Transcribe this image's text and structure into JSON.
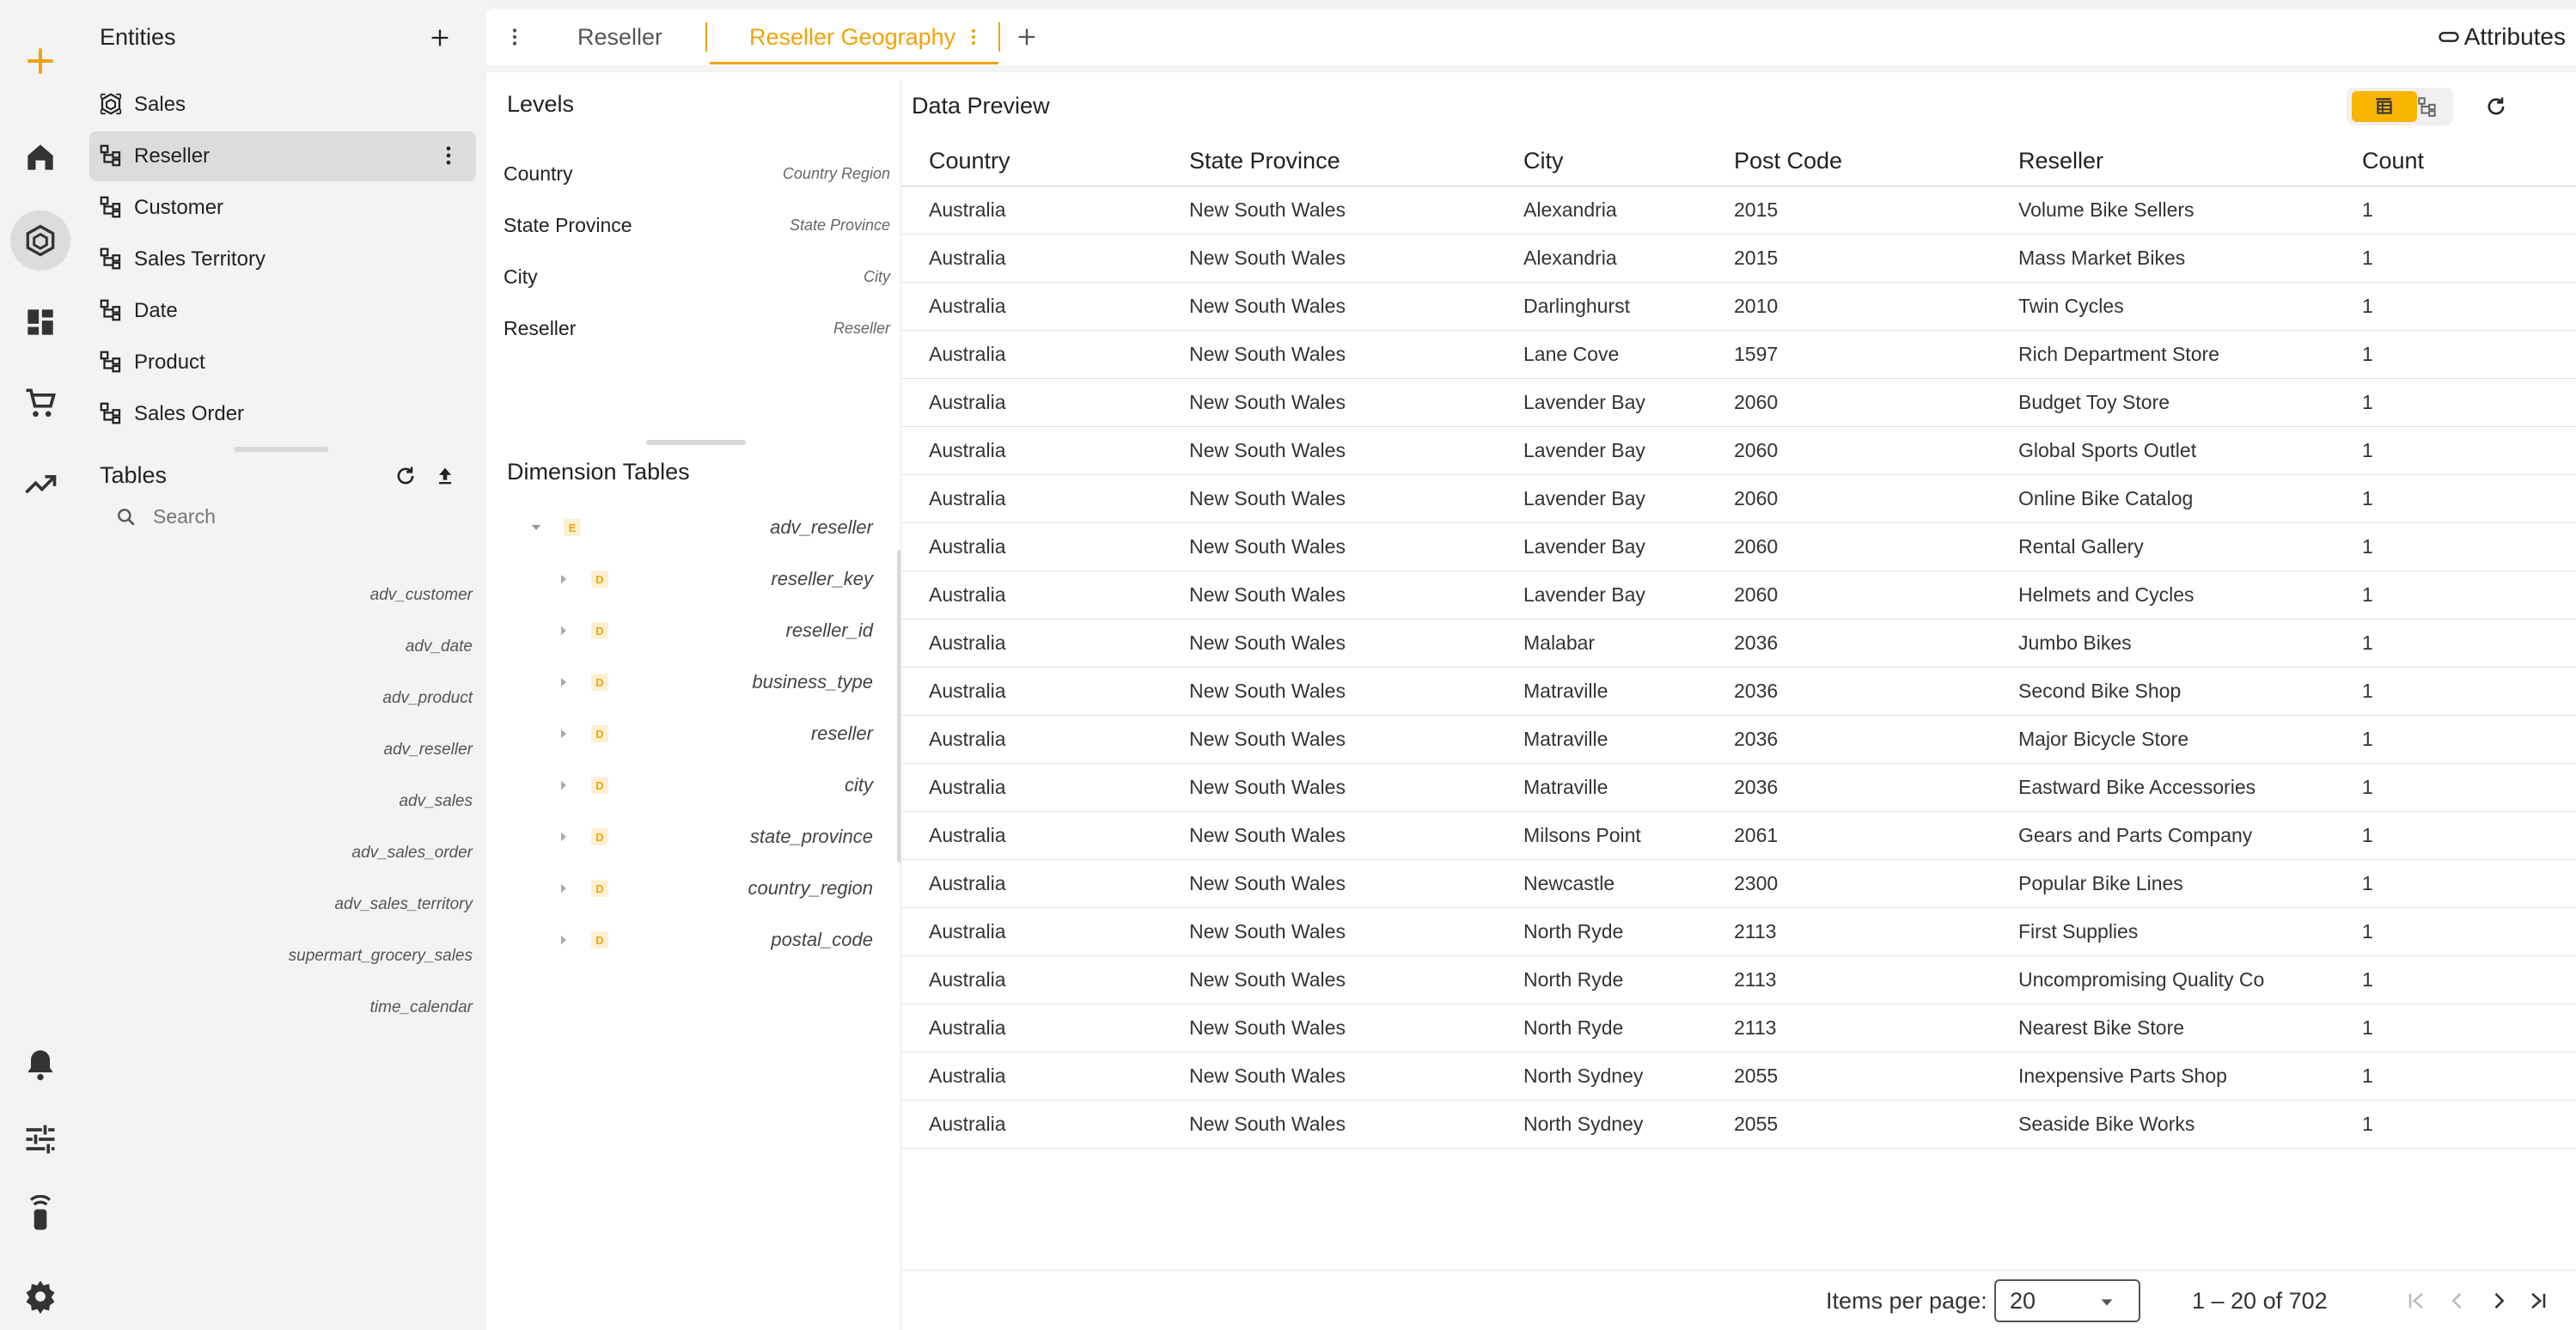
{
  "colors": {
    "accent": "#f0a30a",
    "accent_fill": "#f7b500",
    "selected_bg": "#dcdcdc"
  },
  "rail": {
    "items": [
      "add-icon",
      "home-icon",
      "model-icon",
      "dashboard-icon",
      "cart-icon",
      "trend-icon",
      "bell-icon",
      "tune-icon",
      "remote-icon",
      "gear-icon"
    ]
  },
  "entities": {
    "title": "Entities",
    "items": [
      {
        "label": "Sales",
        "icon": "cube-icon"
      },
      {
        "label": "Reseller",
        "icon": "hierarchy-icon"
      },
      {
        "label": "Customer",
        "icon": "hierarchy-icon"
      },
      {
        "label": "Sales Territory",
        "icon": "hierarchy-icon"
      },
      {
        "label": "Date",
        "icon": "hierarchy-icon"
      },
      {
        "label": "Product",
        "icon": "hierarchy-icon"
      },
      {
        "label": "Sales Order",
        "icon": "hierarchy-icon"
      }
    ],
    "selected": "Reseller"
  },
  "tables": {
    "title": "Tables",
    "search_placeholder": "Search",
    "items": [
      "adv_customer",
      "adv_date",
      "adv_product",
      "adv_reseller",
      "adv_sales",
      "adv_sales_order",
      "adv_sales_territory",
      "supermart_grocery_sales",
      "time_calendar"
    ]
  },
  "tabs": {
    "items": [
      "Reseller",
      "Reseller Geography"
    ],
    "active": "Reseller Geography",
    "attributes_label": "Attributes"
  },
  "levels": {
    "title": "Levels",
    "items": [
      {
        "name": "Country",
        "attr": "Country Region"
      },
      {
        "name": "State Province",
        "attr": "State Province"
      },
      {
        "name": "City",
        "attr": "City"
      },
      {
        "name": "Reseller",
        "attr": "Reseller"
      }
    ]
  },
  "dimension_tables": {
    "title": "Dimension Tables",
    "root": {
      "badge": "E",
      "name": "adv_reseller"
    },
    "fields": [
      {
        "badge": "D",
        "name": "reseller_key"
      },
      {
        "badge": "D",
        "name": "reseller_id"
      },
      {
        "badge": "D",
        "name": "business_type"
      },
      {
        "badge": "D",
        "name": "reseller"
      },
      {
        "badge": "D",
        "name": "city"
      },
      {
        "badge": "D",
        "name": "state_province"
      },
      {
        "badge": "D",
        "name": "country_region"
      },
      {
        "badge": "D",
        "name": "postal_code"
      }
    ]
  },
  "preview": {
    "title": "Data Preview",
    "columns": [
      "Country",
      "State Province",
      "City",
      "Post Code",
      "Reseller",
      "Count"
    ],
    "rows": [
      [
        "Australia",
        "New South Wales",
        "Alexandria",
        "2015",
        "Volume Bike Sellers",
        "1"
      ],
      [
        "Australia",
        "New South Wales",
        "Alexandria",
        "2015",
        "Mass Market Bikes",
        "1"
      ],
      [
        "Australia",
        "New South Wales",
        "Darlinghurst",
        "2010",
        "Twin Cycles",
        "1"
      ],
      [
        "Australia",
        "New South Wales",
        "Lane Cove",
        "1597",
        "Rich Department Store",
        "1"
      ],
      [
        "Australia",
        "New South Wales",
        "Lavender Bay",
        "2060",
        "Budget Toy Store",
        "1"
      ],
      [
        "Australia",
        "New South Wales",
        "Lavender Bay",
        "2060",
        "Global Sports Outlet",
        "1"
      ],
      [
        "Australia",
        "New South Wales",
        "Lavender Bay",
        "2060",
        "Online Bike Catalog",
        "1"
      ],
      [
        "Australia",
        "New South Wales",
        "Lavender Bay",
        "2060",
        "Rental Gallery",
        "1"
      ],
      [
        "Australia",
        "New South Wales",
        "Lavender Bay",
        "2060",
        "Helmets and Cycles",
        "1"
      ],
      [
        "Australia",
        "New South Wales",
        "Malabar",
        "2036",
        "Jumbo Bikes",
        "1"
      ],
      [
        "Australia",
        "New South Wales",
        "Matraville",
        "2036",
        "Second Bike Shop",
        "1"
      ],
      [
        "Australia",
        "New South Wales",
        "Matraville",
        "2036",
        "Major Bicycle Store",
        "1"
      ],
      [
        "Australia",
        "New South Wales",
        "Matraville",
        "2036",
        "Eastward Bike Accessories",
        "1"
      ],
      [
        "Australia",
        "New South Wales",
        "Milsons Point",
        "2061",
        "Gears and Parts Company",
        "1"
      ],
      [
        "Australia",
        "New South Wales",
        "Newcastle",
        "2300",
        "Popular Bike Lines",
        "1"
      ],
      [
        "Australia",
        "New South Wales",
        "North Ryde",
        "2113",
        "First Supplies",
        "1"
      ],
      [
        "Australia",
        "New South Wales",
        "North Ryde",
        "2113",
        "Uncompromising Quality Co",
        "1"
      ],
      [
        "Australia",
        "New South Wales",
        "North Ryde",
        "2113",
        "Nearest Bike Store",
        "1"
      ],
      [
        "Australia",
        "New South Wales",
        "North Sydney",
        "2055",
        "Inexpensive Parts Shop",
        "1"
      ],
      [
        "Australia",
        "New South Wales",
        "North Sydney",
        "2055",
        "Seaside Bike Works",
        "1"
      ]
    ]
  },
  "paginator": {
    "items_per_page_label": "Items per page:",
    "items_per_page_value": "20",
    "range_label": "1 – 20 of 702"
  }
}
